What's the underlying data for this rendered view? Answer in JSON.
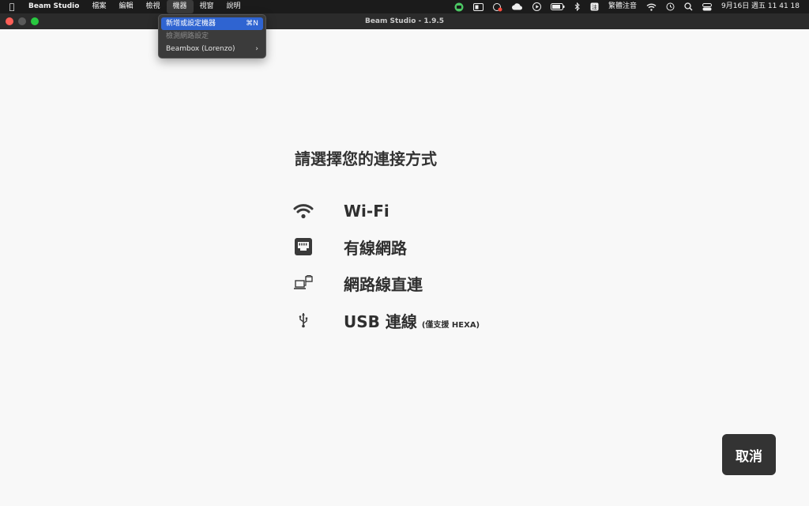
{
  "menubar": {
    "app_name": "Beam Studio",
    "items": [
      "檔案",
      "編輯",
      "檢視",
      "機器",
      "視窗",
      "說明"
    ],
    "input_method": "繁體注音",
    "clock": "9月16日 週五  11 41 18"
  },
  "window": {
    "title": "Beam Studio - 1.9.5"
  },
  "dropdown": {
    "items": [
      {
        "label": "新增或設定機器",
        "shortcut": "⌘N"
      },
      {
        "label": "檢測網路設定",
        "shortcut": ""
      },
      {
        "label": "Beambox (Lorenzo)",
        "shortcut": "›"
      }
    ]
  },
  "main": {
    "heading": "請選擇您的連接方式",
    "options": [
      {
        "label": "Wi-Fi",
        "icon": "wifi-icon"
      },
      {
        "label": "有線網路",
        "icon": "ethernet-port-icon"
      },
      {
        "label": "網路線直連",
        "icon": "direct-connect-icon"
      },
      {
        "label": "USB 連線",
        "icon": "usb-icon",
        "note": "(僅支援 HEXA)"
      }
    ],
    "cancel_label": "取消"
  },
  "colors": {
    "menubar_bg": "#1b1b1b",
    "highlight": "#2f64d1",
    "close_light": "#ff5f57",
    "minimize_light": "#5a5a5a",
    "zoom_light": "#28c840",
    "button_bg": "#333333"
  }
}
